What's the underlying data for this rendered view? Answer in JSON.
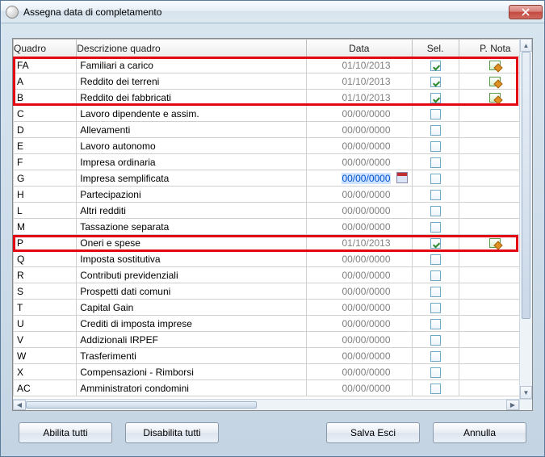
{
  "window": {
    "title": "Assegna data di completamento"
  },
  "columns": {
    "quadro": "Quadro",
    "descrizione": "Descrizione quadro",
    "data": "Data",
    "sel": "Sel.",
    "nota": "P. Nota"
  },
  "rows": [
    {
      "q": "FA",
      "desc": "Familiari a carico",
      "date": "01/10/2013",
      "sel": true,
      "note": true,
      "hl": true
    },
    {
      "q": "A",
      "desc": "Reddito dei terreni",
      "date": "01/10/2013",
      "sel": true,
      "note": true,
      "hl": true
    },
    {
      "q": "B",
      "desc": "Reddito dei fabbricati",
      "date": "01/10/2013",
      "sel": true,
      "note": true,
      "hl": true
    },
    {
      "q": "C",
      "desc": "Lavoro dipendente e assim.",
      "date": "00/00/0000",
      "sel": false,
      "note": false,
      "hl": false
    },
    {
      "q": "D",
      "desc": "Allevamenti",
      "date": "00/00/0000",
      "sel": false,
      "note": false,
      "hl": false
    },
    {
      "q": "E",
      "desc": "Lavoro autonomo",
      "date": "00/00/0000",
      "sel": false,
      "note": false,
      "hl": false
    },
    {
      "q": "F",
      "desc": "Impresa ordinaria",
      "date": "00/00/0000",
      "sel": false,
      "note": false,
      "hl": false
    },
    {
      "q": "G",
      "desc": "Impresa semplificata",
      "date": "00/00/0000",
      "sel": false,
      "note": false,
      "hl": false,
      "active": true
    },
    {
      "q": "H",
      "desc": "Partecipazioni",
      "date": "00/00/0000",
      "sel": false,
      "note": false,
      "hl": false
    },
    {
      "q": "L",
      "desc": "Altri redditi",
      "date": "00/00/0000",
      "sel": false,
      "note": false,
      "hl": false
    },
    {
      "q": "M",
      "desc": "Tassazione separata",
      "date": "00/00/0000",
      "sel": false,
      "note": false,
      "hl": false
    },
    {
      "q": "P",
      "desc": "Oneri e spese",
      "date": "01/10/2013",
      "sel": true,
      "note": true,
      "hl": true
    },
    {
      "q": "Q",
      "desc": "Imposta sostitutiva",
      "date": "00/00/0000",
      "sel": false,
      "note": false,
      "hl": false
    },
    {
      "q": "R",
      "desc": "Contributi previdenziali",
      "date": "00/00/0000",
      "sel": false,
      "note": false,
      "hl": false
    },
    {
      "q": "S",
      "desc": "Prospetti dati comuni",
      "date": "00/00/0000",
      "sel": false,
      "note": false,
      "hl": false
    },
    {
      "q": "T",
      "desc": "Capital Gain",
      "date": "00/00/0000",
      "sel": false,
      "note": false,
      "hl": false
    },
    {
      "q": "U",
      "desc": "Crediti di imposta imprese",
      "date": "00/00/0000",
      "sel": false,
      "note": false,
      "hl": false
    },
    {
      "q": "V",
      "desc": "Addizionali IRPEF",
      "date": "00/00/0000",
      "sel": false,
      "note": false,
      "hl": false
    },
    {
      "q": "W",
      "desc": "Trasferimenti",
      "date": "00/00/0000",
      "sel": false,
      "note": false,
      "hl": false
    },
    {
      "q": "X",
      "desc": "Compensazioni - Rimborsi",
      "date": "00/00/0000",
      "sel": false,
      "note": false,
      "hl": false
    },
    {
      "q": "AC",
      "desc": "Amministratori condomini",
      "date": "00/00/0000",
      "sel": false,
      "note": false,
      "hl": false
    }
  ],
  "buttons": {
    "enable_all": "Abilita tutti",
    "disable_all": "Disabilita tutti",
    "save_exit": "Salva Esci",
    "cancel": "Annulla"
  }
}
